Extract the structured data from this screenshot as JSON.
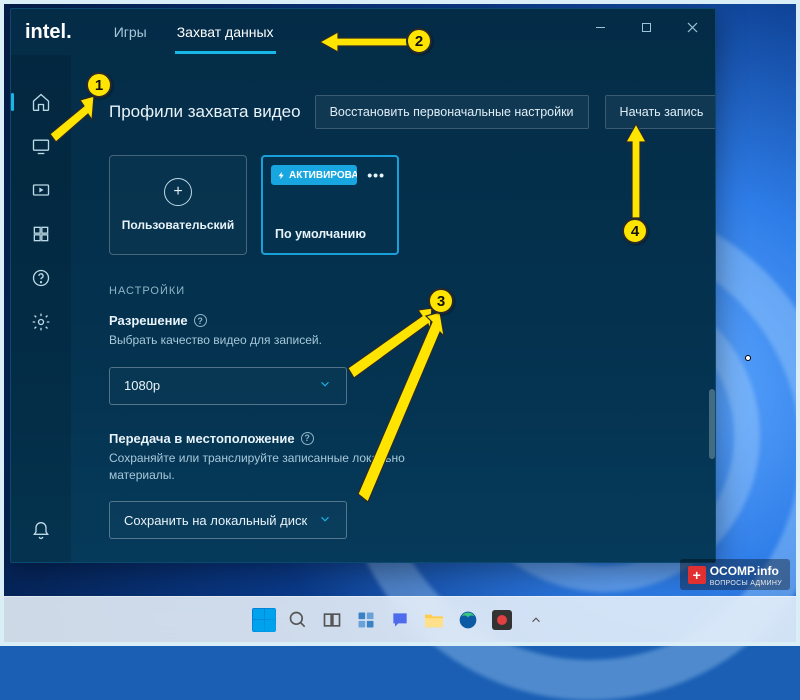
{
  "window": {
    "logo": "intel",
    "tabs": {
      "games": "Игры",
      "capture": "Захват данных"
    }
  },
  "header": {
    "title": "Профили захвата видео",
    "restore_btn": "Восстановить первоначальные настройки",
    "record_btn": "Начать запись"
  },
  "profiles": {
    "custom_label": "Пользовательский",
    "default_label": "По умолчанию",
    "active_badge": "АКТИВИРОВА..."
  },
  "settings": {
    "section_label": "НАСТРОЙКИ",
    "resolution": {
      "title": "Разрешение",
      "desc": "Выбрать качество видео для записей.",
      "value": "1080p"
    },
    "destination": {
      "title": "Передача в местоположение",
      "desc": "Сохраняйте или транслируйте записанные локально материалы.",
      "value": "Сохранить на локальный диск"
    }
  },
  "markers": {
    "m1": "1",
    "m2": "2",
    "m3": "3",
    "m4": "4"
  },
  "watermark": {
    "main": "OCOMP.info",
    "sub": "ВОПРОСЫ АДМИНУ"
  }
}
